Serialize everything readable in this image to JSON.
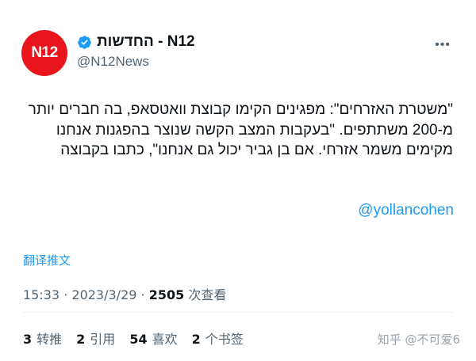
{
  "author": {
    "avatar_text": "N12",
    "display_name": "N12 - החדשות",
    "handle": "@N12News"
  },
  "tweet": {
    "text": "\"משטרת האזרחים\": מפגינים הקימו קבוצת וואטסאפ, בה חברים יותר מ-200 משתתפים. \"בעקבות המצב הקשה שנוצר בהפגנות אנחנו מקימים משמר אזרחי. אם בן גביר יכול גם אנחנו\", כתבו בקבוצה",
    "mention": "@yollancohen",
    "translate_label": "翻译推文",
    "time": "15:33",
    "date": "2023/3/29",
    "separator": "·",
    "views_count": "2505",
    "views_label": "次查看"
  },
  "stats": [
    {
      "count": "3",
      "label": "转推"
    },
    {
      "count": "2",
      "label": "引用"
    },
    {
      "count": "54",
      "label": "喜欢"
    },
    {
      "count": "2",
      "label": "个书签"
    }
  ],
  "watermark": "知乎 @不可爱6",
  "colors": {
    "accent": "#1d9bf0",
    "avatar_bg": "#e8161c",
    "muted": "#536471"
  }
}
